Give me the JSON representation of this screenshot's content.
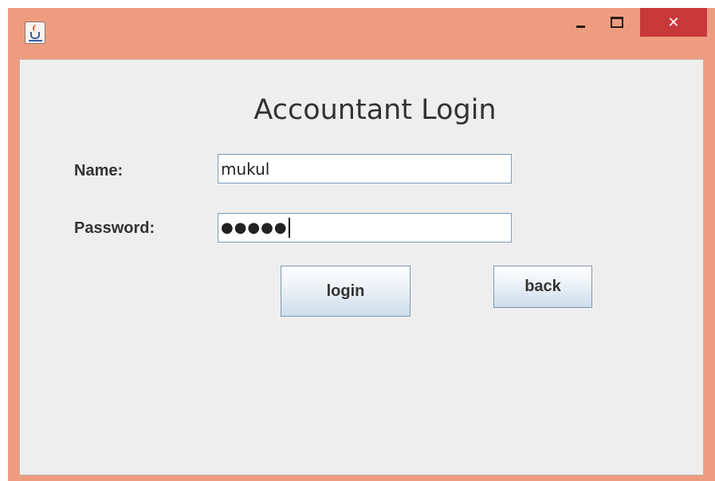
{
  "window": {
    "controls": {
      "minimize_icon": "minimize-icon",
      "maximize_icon": "maximize-icon",
      "close_glyph": "✕"
    },
    "app_icon": "java-icon",
    "colors": {
      "frame": "#ee9c80",
      "close": "#c7383a",
      "content_bg": "#eeeeee"
    }
  },
  "form": {
    "title": "Accountant Login",
    "name_label": "Name:",
    "name_value": "mukul",
    "password_label": "Password:",
    "password_value": "●●●●●",
    "login_label": "login",
    "back_label": "back"
  }
}
